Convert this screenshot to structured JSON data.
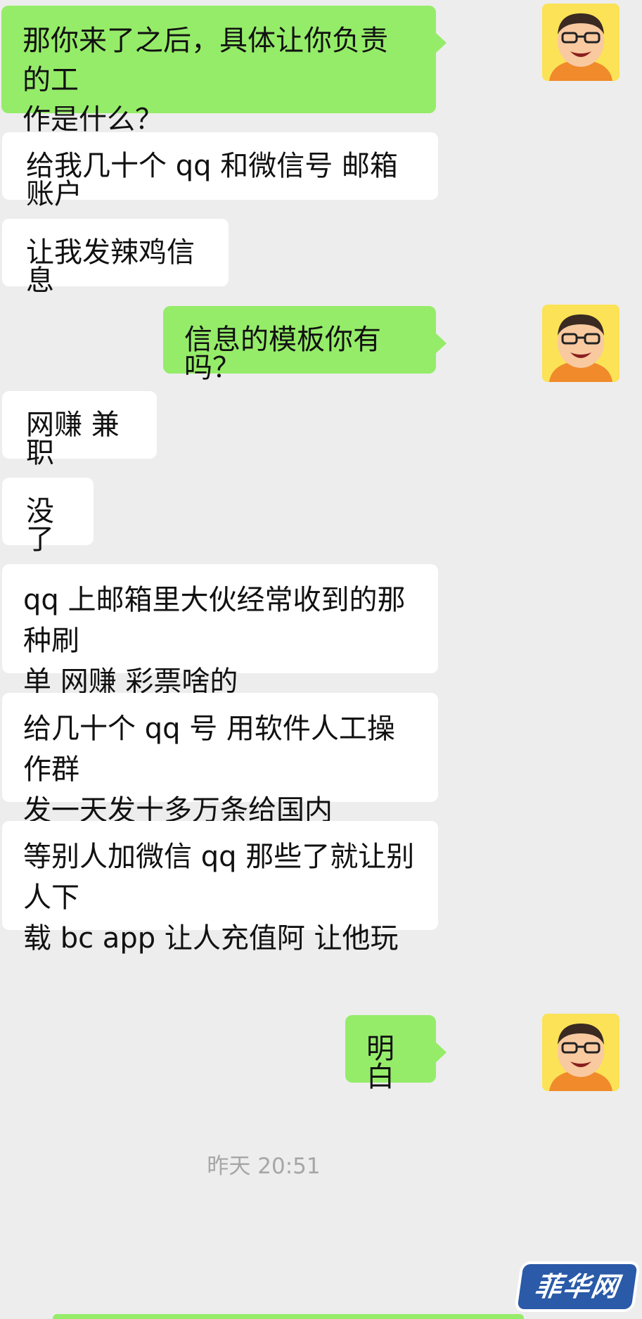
{
  "messages": [
    {
      "side": "out",
      "text": "那你来了之后，具体让你负责的工\n作是什么？"
    },
    {
      "side": "in",
      "text": "给我几十个 qq 和微信号 邮箱账户"
    },
    {
      "side": "in",
      "text": "让我发辣鸡信息"
    },
    {
      "side": "out",
      "text": "信息的模板你有吗？"
    },
    {
      "side": "in",
      "text": "网赚 兼职"
    },
    {
      "side": "in",
      "text": "没了"
    },
    {
      "side": "in",
      "text": "qq 上邮箱里大伙经常收到的那种刷\n单 网赚 彩票啥的"
    },
    {
      "side": "in",
      "text": "给几十个 qq 号 用软件人工操作群\n发一天发十多万条给国内"
    },
    {
      "side": "in",
      "text": "等别人加微信 qq 那些了就让别人下\n载 bc app 让人充值阿 让他玩"
    },
    {
      "side": "out",
      "text": "明白"
    }
  ],
  "timestamp": "昨天 20:51",
  "watermark": "菲华网",
  "colors": {
    "outgoing_bubble": "#95ec69",
    "incoming_bubble": "#ffffff",
    "background": "#ededed",
    "watermark_bg": "#2a5aa8"
  },
  "avatar_icon": "cartoon-man-with-glasses"
}
